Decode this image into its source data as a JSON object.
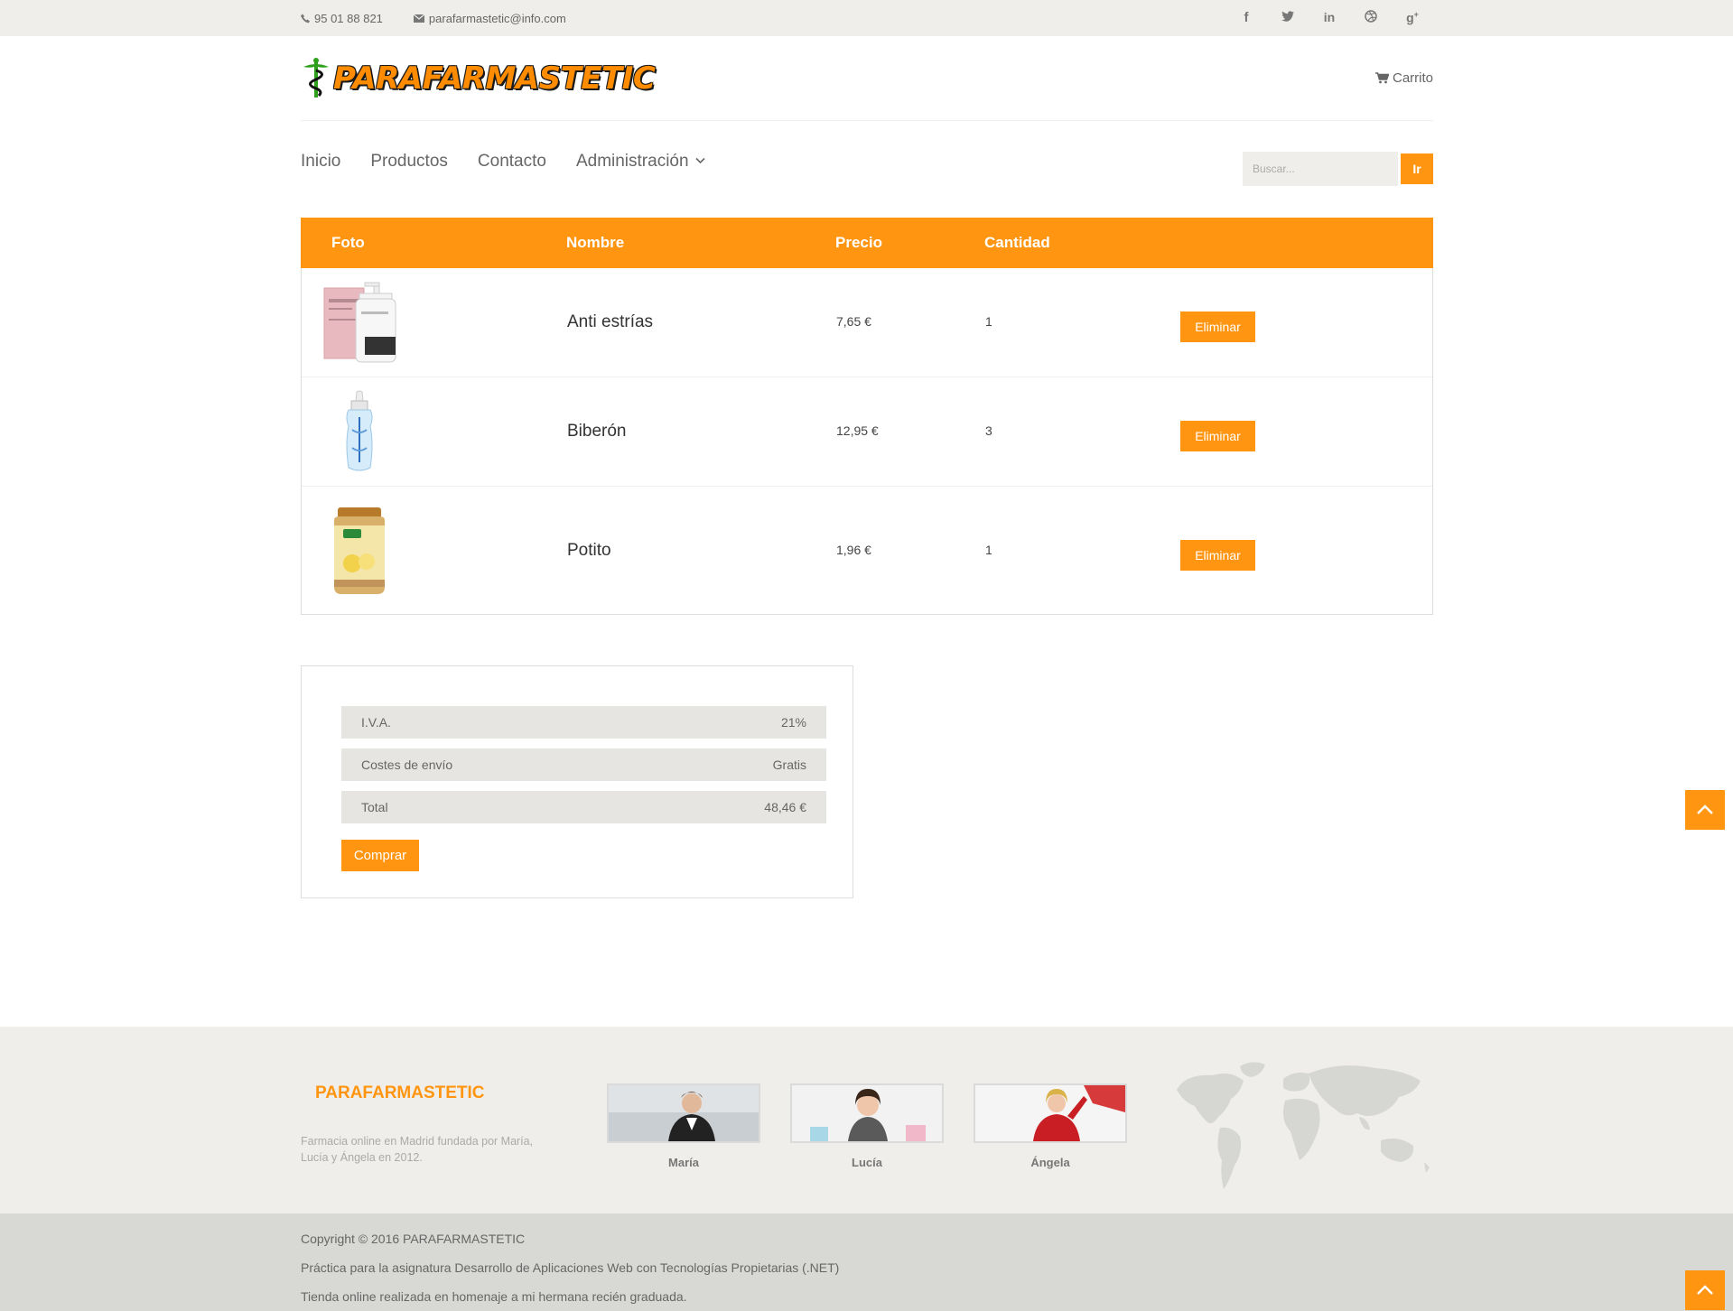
{
  "topbar": {
    "phone": "95 01 88 821",
    "email": "parafarmastetic@info.com",
    "socials": [
      "f",
      "twitter",
      "in",
      "dribbble",
      "g+"
    ]
  },
  "header": {
    "logo": "PARAFARMASTETIC",
    "cart_label": "Carrito"
  },
  "nav": {
    "items": [
      "Inicio",
      "Productos",
      "Contacto",
      "Administración"
    ],
    "search_placeholder": "Buscar...",
    "search_button": "Ir"
  },
  "cart": {
    "headers": [
      "Foto",
      "Nombre",
      "Precio",
      "Cantidad"
    ],
    "rows": [
      {
        "name": "Anti estrías",
        "price": "7,65 €",
        "qty": "1",
        "action": "Eliminar",
        "image_icon": "cream-bottle-icon"
      },
      {
        "name": "Biberón",
        "price": "12,95 €",
        "qty": "3",
        "action": "Eliminar",
        "image_icon": "baby-bottle-icon"
      },
      {
        "name": "Potito",
        "price": "1,96 €",
        "qty": "1",
        "action": "Eliminar",
        "image_icon": "baby-food-jar-icon"
      }
    ]
  },
  "totals": {
    "iva_label": "I.V.A.",
    "iva_value": "21%",
    "shipping_label": "Costes de envío",
    "shipping_value": "Gratis",
    "total_label": "Total",
    "total_value": "48,46 €",
    "buy_button": "Comprar"
  },
  "footer": {
    "brand": "PARAFARMASTETIC",
    "description": "Farmacia online en Madrid fundada por María, Lucía y Ángela en 2012.",
    "team": [
      "María",
      "Lucía",
      "Ángela"
    ],
    "copyright": "Copyright © 2016 PARAFARMASTETIC",
    "line2": "Práctica para la asignatura Desarrollo de Aplicaciones Web con Tecnologías Propietarias (.NET)",
    "line3": "Tienda online realizada en homenaje a mi hermana recién graduada."
  },
  "colors": {
    "accent": "#ff9510",
    "topbar_bg": "#efeeea",
    "footer_bg": "#efeeea",
    "bottom_bg": "#d8d8d4"
  }
}
